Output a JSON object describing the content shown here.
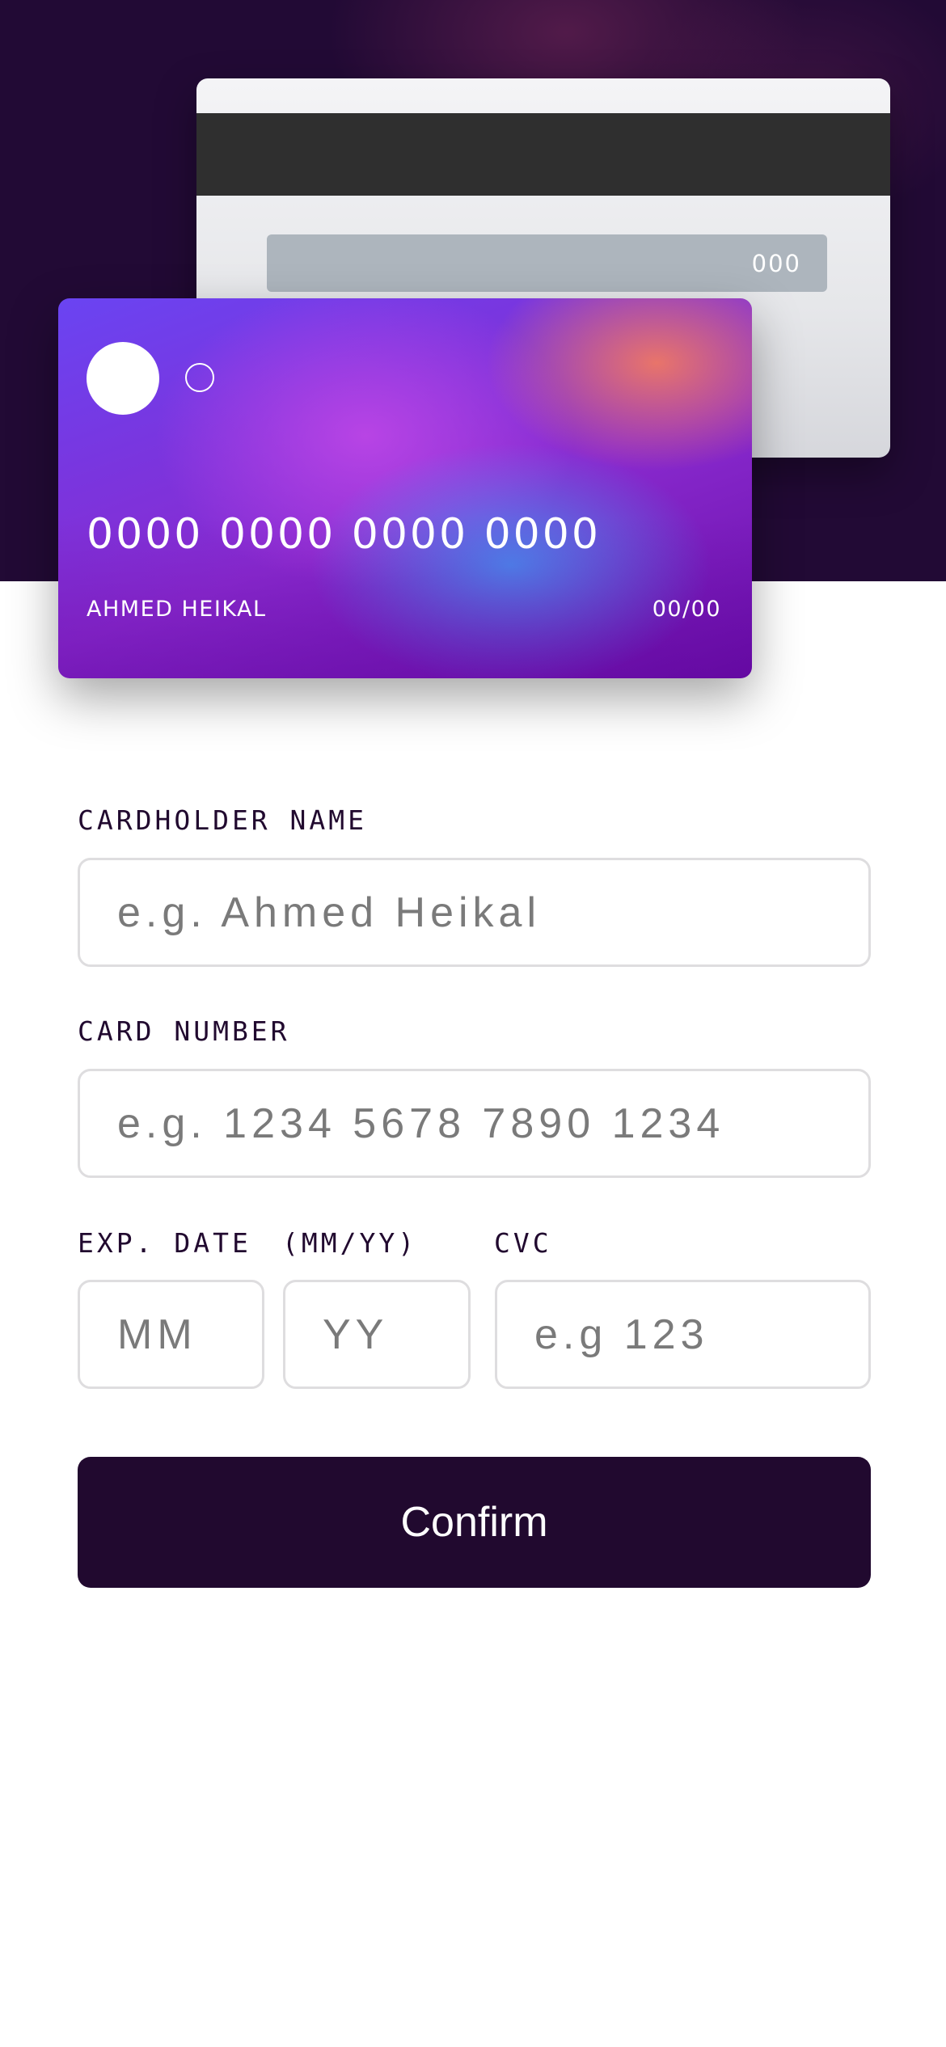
{
  "card": {
    "back": {
      "cvc": "000"
    },
    "front": {
      "number": "0000 0000 0000 0000",
      "holder": "AHMED HEIKAL",
      "expiry": "00/00"
    }
  },
  "form": {
    "cardholder": {
      "label": "CARDHOLDER NAME",
      "placeholder": "e.g. Ahmed Heikal"
    },
    "number": {
      "label": "CARD NUMBER",
      "placeholder": "e.g. 1234 5678 7890 1234"
    },
    "expiry": {
      "label": "EXP. DATE",
      "label_format": "(MM/YY)",
      "month_placeholder": "MM",
      "year_placeholder": "YY"
    },
    "cvc": {
      "label": "CVC",
      "placeholder": "e.g 123"
    },
    "confirm_label": "Confirm"
  },
  "colors": {
    "header_bg": "#220a35",
    "button_bg": "#21092f",
    "input_border": "#dedddf",
    "card_back_stripe": "#2f2f2f",
    "card_back_signature": "#adb5bd"
  }
}
